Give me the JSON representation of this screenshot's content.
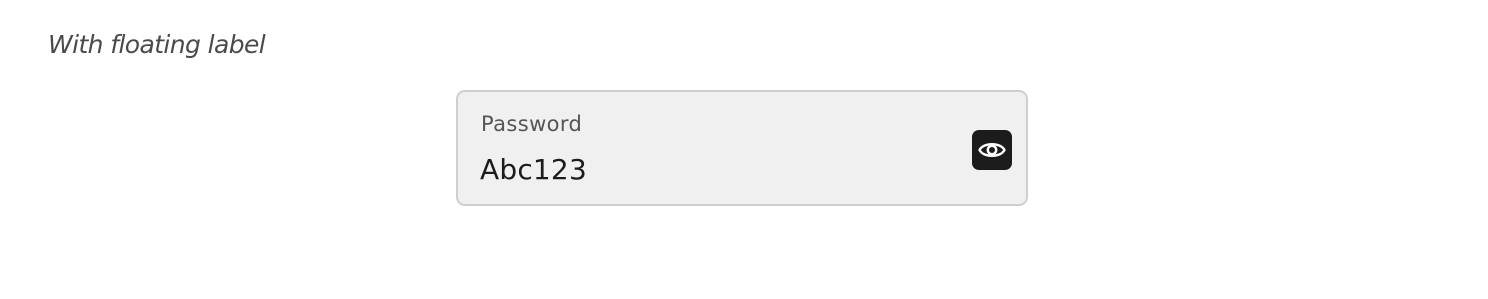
{
  "section": {
    "caption": "With floating label"
  },
  "password_field": {
    "label": "Password",
    "value": "Abc123",
    "input_type": "text",
    "toggle_icon": "eye-icon",
    "toggle_aria_label": "Toggle password visibility"
  },
  "colors": {
    "field_background": "#f0f0f0",
    "field_border": "#cfcfcf",
    "toggle_background": "#1c1c1c",
    "toggle_icon": "#ffffff",
    "label_text": "#555555",
    "value_text": "#1c1c1c",
    "caption_text": "#4a4a4a"
  }
}
